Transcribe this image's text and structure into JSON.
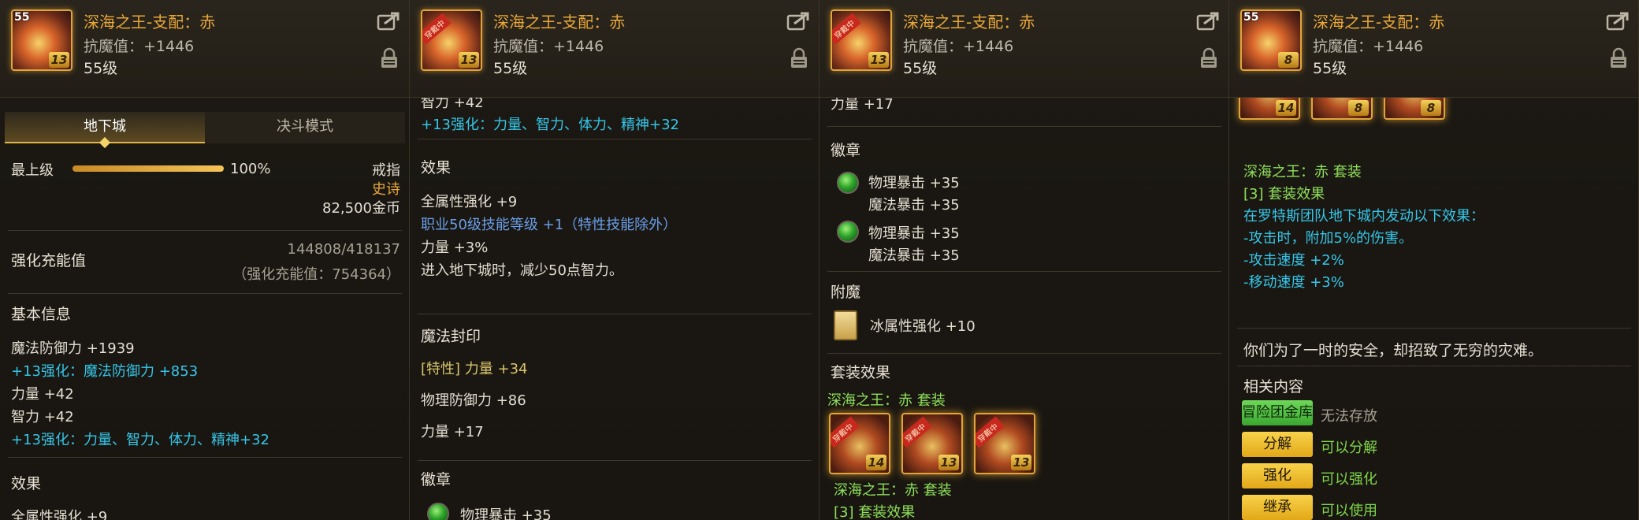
{
  "item": {
    "name": "深海之王-支配：赤",
    "stat": "抗魔值：+1446",
    "level": "55级",
    "icon_badge": "13",
    "icon_badge_p1": "13",
    "icon_badge_p4": "8",
    "level_tag": "55",
    "ribbon": "穿戴中"
  },
  "icons": [
    "share-icon",
    "lock-icon",
    "green-orb-icon",
    "card-icon"
  ],
  "colors": {
    "accent": "#e9a73a",
    "cyan": "#35c6e8",
    "green": "#7fd64a",
    "yellow_button": "#f8d24a"
  },
  "panel1": {
    "tabs": [
      "地下城",
      "决斗模式"
    ],
    "grade_label": "最上级",
    "grade_progress": 1.0,
    "grade_percent": "100%",
    "slot": "戒指",
    "rarity": "史诗",
    "price": "82,500金币",
    "charge_label": "强化充能值",
    "charge_value": "144808/418137",
    "charge_note": "（强化充能值：754364）",
    "basic_title": "基本信息",
    "stats": [
      "魔法防御力 +1939",
      "+13强化：魔法防御力 +853",
      "力量 +42",
      "智力 +42",
      "+13强化：力量、智力、体力、精神+32"
    ],
    "effect_title": "效果",
    "effect_cut": "全属性强化 +9"
  },
  "panel2": {
    "top_cut": "智力 +42",
    "enhance": "+13强化：力量、智力、体力、精神+32",
    "effect_title": "效果",
    "effects": [
      "全属性强化 +9",
      "职业50级技能等级 +1（特性技能除外）",
      "力量 +3%",
      "进入地下城时，减少50点智力。"
    ],
    "seal_title": "魔法封印",
    "seal_lines": [
      "[特性] 力量 +34",
      "物理防御力 +86",
      "力量 +17"
    ],
    "emblem_title": "徽章",
    "emblem_cut": "物理暴击 +35"
  },
  "panel3": {
    "top_cut": "力量 +17",
    "emblem_title": "徽章",
    "emblem1": [
      "物理暴击 +35",
      "魔法暴击 +35"
    ],
    "emblem2": [
      "物理暴击 +35",
      "魔法暴击 +35"
    ],
    "enchant_title": "附魔",
    "enchant": "冰属性强化 +10",
    "set_title": "套装效果",
    "set_name": "深海之王：赤 套装",
    "set_badges": [
      "14",
      "13",
      "13"
    ],
    "set_name2": "深海之王：赤 套装",
    "set_bonus_cut": "[3] 套装效果"
  },
  "panel4": {
    "set_badges": [
      "14",
      "8",
      "8"
    ],
    "set_name": "深海之王：赤 套装",
    "set_bonus": "[3] 套装效果",
    "set_lines": [
      "在罗特斯团队地下城内发动以下效果：",
      "-攻击时，附加5%的伤害。",
      "-攻击速度 +2%",
      "-移动速度 +3%"
    ],
    "flavor": "你们为了一时的安全，却招致了无穷的灾难。",
    "related_title": "相关内容",
    "actions": [
      {
        "button": "冒险团金库",
        "status": "无法存放"
      },
      {
        "button": "分解",
        "status": "可以分解"
      },
      {
        "button": "强化",
        "status": "可以强化"
      },
      {
        "button": "继承",
        "status": "可以使用"
      }
    ]
  }
}
